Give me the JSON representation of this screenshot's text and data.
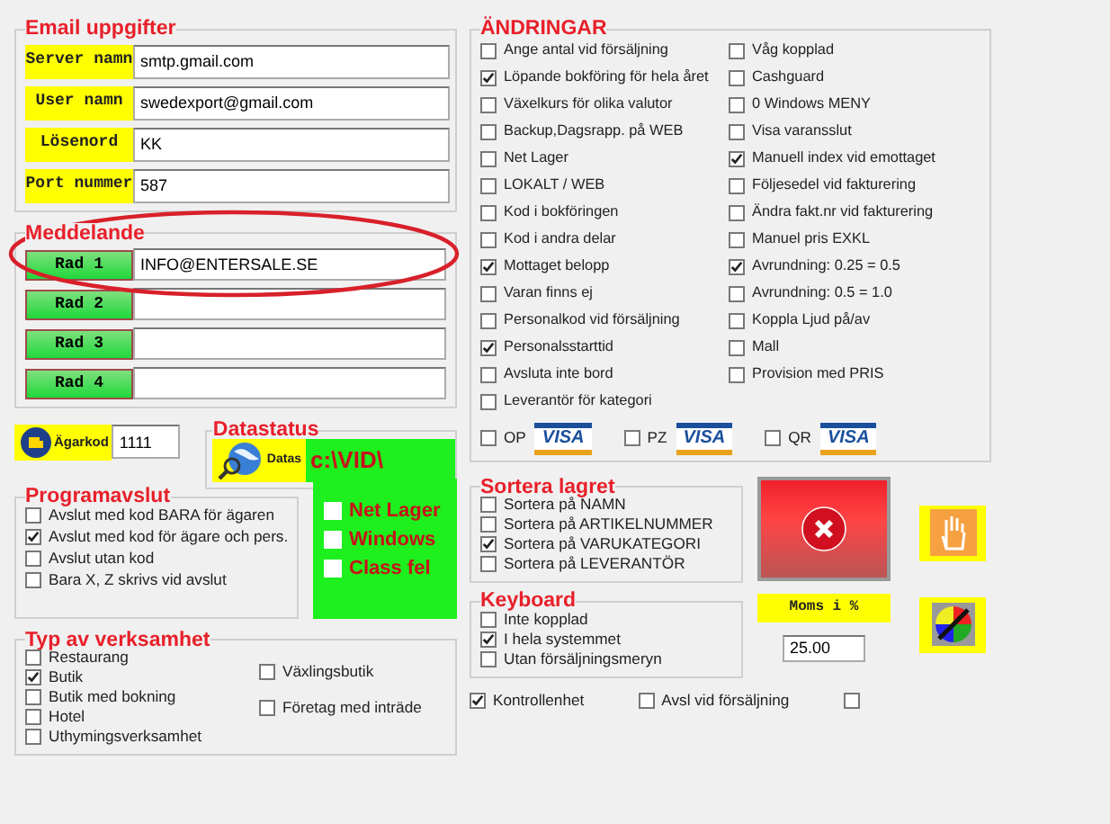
{
  "email_settings": {
    "title": "Email uppgifter",
    "fields": [
      {
        "label": "Server namn",
        "value": "smtp.gmail.com"
      },
      {
        "label": "User namn",
        "value": "swedexport@gmail.com"
      },
      {
        "label": "Lösenord",
        "value": "KK"
      },
      {
        "label": "Port nummer",
        "value": "587"
      }
    ]
  },
  "message": {
    "title": "Meddelande",
    "rows": [
      {
        "label": "Rad 1",
        "value": "INFO@ENTERSALE.SE"
      },
      {
        "label": "Rad 2"
      },
      {
        "label": "Rad 3"
      },
      {
        "label": "Rad 4"
      }
    ]
  },
  "owner_code": {
    "label": "Ägarkod",
    "value": "1111"
  },
  "data_status": {
    "title": "Datastatus",
    "label": "Datas",
    "path": "c:\\VID\\"
  },
  "status_flags": [
    {
      "label": "Net Lager",
      "checked": false
    },
    {
      "label": "Windows",
      "checked": false
    },
    {
      "label": "Class fel",
      "checked": false
    }
  ],
  "program_exit": {
    "title": "Programavslut",
    "options": [
      {
        "label": "Avslut med kod BARA för ägaren",
        "checked": false
      },
      {
        "label": "Avslut med kod för ägare och pers.",
        "checked": true
      },
      {
        "label": "Avslut utan kod",
        "checked": false
      },
      {
        "label": "Bara X, Z skrivs vid avslut",
        "checked": false
      }
    ]
  },
  "business_type": {
    "title": "Typ av verksamhet",
    "options": [
      {
        "label": "Restaurang",
        "checked": false
      },
      {
        "label": "Butik",
        "checked": true
      },
      {
        "label": "Butik med bokning",
        "checked": false
      },
      {
        "label": "Hotel",
        "checked": false
      },
      {
        "label": "Uthymingsverksamhet",
        "checked": false
      }
    ],
    "other_options": [
      {
        "label": "Växlingsbutik",
        "checked": false
      },
      {
        "label": "Företag med inträde",
        "checked": false
      }
    ]
  },
  "changes": {
    "title": "ÄNDRINGAR",
    "left_options": [
      {
        "label": "Ange antal vid försäljning",
        "checked": false
      },
      {
        "label": "Löpande bokföring för hela året",
        "checked": true
      },
      {
        "label": "Växelkurs för olika valutor",
        "checked": false
      },
      {
        "label": "Backup,Dagsrapp. på WEB",
        "checked": false
      },
      {
        "label": "Net Lager",
        "checked": false
      },
      {
        "label": "LOKALT / WEB",
        "checked": false
      },
      {
        "label": "Kod i bokföringen",
        "checked": false
      },
      {
        "label": "Kod i andra delar",
        "checked": false
      },
      {
        "label": "Mottaget belopp",
        "checked": true
      },
      {
        "label": "Varan finns ej",
        "checked": false
      },
      {
        "label": "Personalkod vid försäljning",
        "checked": false
      },
      {
        "label": "Personalsstarttid",
        "checked": true
      },
      {
        "label": "Avsluta inte bord",
        "checked": false
      },
      {
        "label": "Leverantör för kategori",
        "checked": false
      }
    ],
    "right_options": [
      {
        "label": "Våg kopplad",
        "checked": false
      },
      {
        "label": "Cashguard",
        "checked": false
      },
      {
        "label": "0 Windows MENY",
        "checked": false
      },
      {
        "label": "Visa varansslut",
        "checked": false
      },
      {
        "label": "Manuell index vid emottaget",
        "checked": true
      },
      {
        "label": "Följesedel vid fakturering",
        "checked": false
      },
      {
        "label": "Ändra fakt.nr vid fakturering",
        "checked": false
      },
      {
        "label": "Manuel pris EXKL",
        "checked": false
      },
      {
        "label": "Avrundning: 0.25 = 0.5",
        "checked": true
      },
      {
        "label": "Avrundning: 0.5 = 1.0",
        "checked": false
      },
      {
        "label": "Koppla Ljud på/av",
        "checked": false
      },
      {
        "label": "Mall",
        "checked": false
      },
      {
        "label": "Provision med PRIS",
        "checked": false
      }
    ],
    "payments": [
      {
        "label": "OP",
        "checked": false,
        "card": "VISA"
      },
      {
        "label": "PZ",
        "checked": false,
        "card": "VISA"
      },
      {
        "label": "QR",
        "checked": false,
        "card": "VISA"
      }
    ]
  },
  "sort_stock": {
    "title": "Sortera lagret",
    "options": [
      {
        "label": "Sortera på NAMN",
        "checked": false
      },
      {
        "label": "Sortera på ARTIKELNUMMER",
        "checked": false
      },
      {
        "label": "Sortera på VARUKATEGORI",
        "checked": true
      },
      {
        "label": "Sortera på LEVERANTÖR",
        "checked": false
      }
    ]
  },
  "keyboard": {
    "title": "Keyboard",
    "options": [
      {
        "label": "Inte kopplad",
        "checked": false
      },
      {
        "label": "I hela systemmet",
        "checked": true
      },
      {
        "label": "Utan försäljningsmeryn",
        "checked": false
      }
    ]
  },
  "vat": {
    "label": "Moms i %",
    "value": "25.00"
  },
  "bottom_options": [
    {
      "label": "Kontrollenhet",
      "checked": true
    },
    {
      "label": "Avsl vid försäljning",
      "checked": false
    },
    {
      "checked": false
    }
  ]
}
